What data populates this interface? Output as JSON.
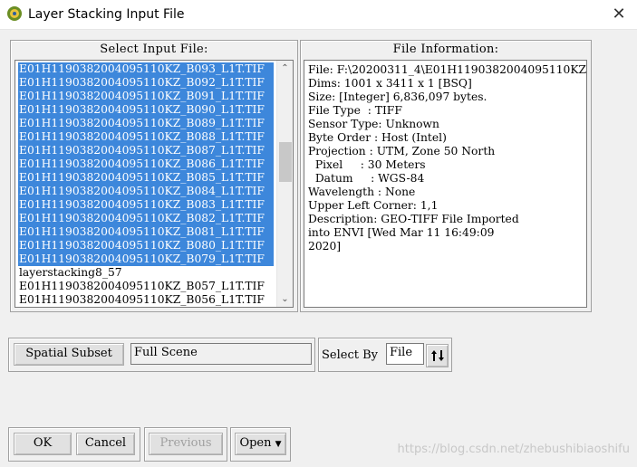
{
  "window": {
    "title": "Layer Stacking Input File"
  },
  "select_panel": {
    "title": "Select Input File:",
    "items": [
      {
        "label": "E01H1190382004095110KZ_B093_L1T.TIF",
        "selected": true
      },
      {
        "label": "E01H1190382004095110KZ_B092_L1T.TIF",
        "selected": true
      },
      {
        "label": "E01H1190382004095110KZ_B091_L1T.TIF",
        "selected": true
      },
      {
        "label": "E01H1190382004095110KZ_B090_L1T.TIF",
        "selected": true
      },
      {
        "label": "E01H1190382004095110KZ_B089_L1T.TIF",
        "selected": true
      },
      {
        "label": "E01H1190382004095110KZ_B088_L1T.TIF",
        "selected": true
      },
      {
        "label": "E01H1190382004095110KZ_B087_L1T.TIF",
        "selected": true
      },
      {
        "label": "E01H1190382004095110KZ_B086_L1T.TIF",
        "selected": true
      },
      {
        "label": "E01H1190382004095110KZ_B085_L1T.TIF",
        "selected": true
      },
      {
        "label": "E01H1190382004095110KZ_B084_L1T.TIF",
        "selected": true
      },
      {
        "label": "E01H1190382004095110KZ_B083_L1T.TIF",
        "selected": true
      },
      {
        "label": "E01H1190382004095110KZ_B082_L1T.TIF",
        "selected": true
      },
      {
        "label": "E01H1190382004095110KZ_B081_L1T.TIF",
        "selected": true
      },
      {
        "label": "E01H1190382004095110KZ_B080_L1T.TIF",
        "selected": true
      },
      {
        "label": "E01H1190382004095110KZ_B079_L1T.TIF",
        "selected": true
      },
      {
        "label": "layerstacking8_57",
        "selected": false
      },
      {
        "label": "E01H1190382004095110KZ_B057_L1T.TIF",
        "selected": false
      },
      {
        "label": "E01H1190382004095110KZ_B056_L1T.TIF",
        "selected": false
      }
    ]
  },
  "info_panel": {
    "title": "File Information:",
    "lines": [
      "File: F:\\20200311_4\\E01H1190382004095110KZ",
      "Dims: 1001 x 3411 x 1 [BSQ]",
      "Size: [Integer] 6,836,097 bytes.",
      "File Type  : TIFF",
      "Sensor Type: Unknown",
      "Byte Order : Host (Intel)",
      "Projection : UTM, Zone 50 North",
      "  Pixel     : 30 Meters",
      "  Datum     : WGS-84",
      "Wavelength : None",
      "Upper Left Corner: 1,1",
      "Description: GEO-TIFF File Imported",
      "into ENVI [Wed Mar 11 16:49:09",
      "2020]"
    ]
  },
  "subset": {
    "button_label": "Spatial Subset",
    "value": "Full Scene",
    "select_by_label": "Select By",
    "select_by_value": "File"
  },
  "buttons": {
    "ok": "OK",
    "cancel": "Cancel",
    "previous": "Previous",
    "open": "Open"
  },
  "watermark": "https://blog.csdn.net/zhebushibiaoshifu",
  "colors": {
    "selection": "#3d87db",
    "background": "#f0f0f0"
  }
}
